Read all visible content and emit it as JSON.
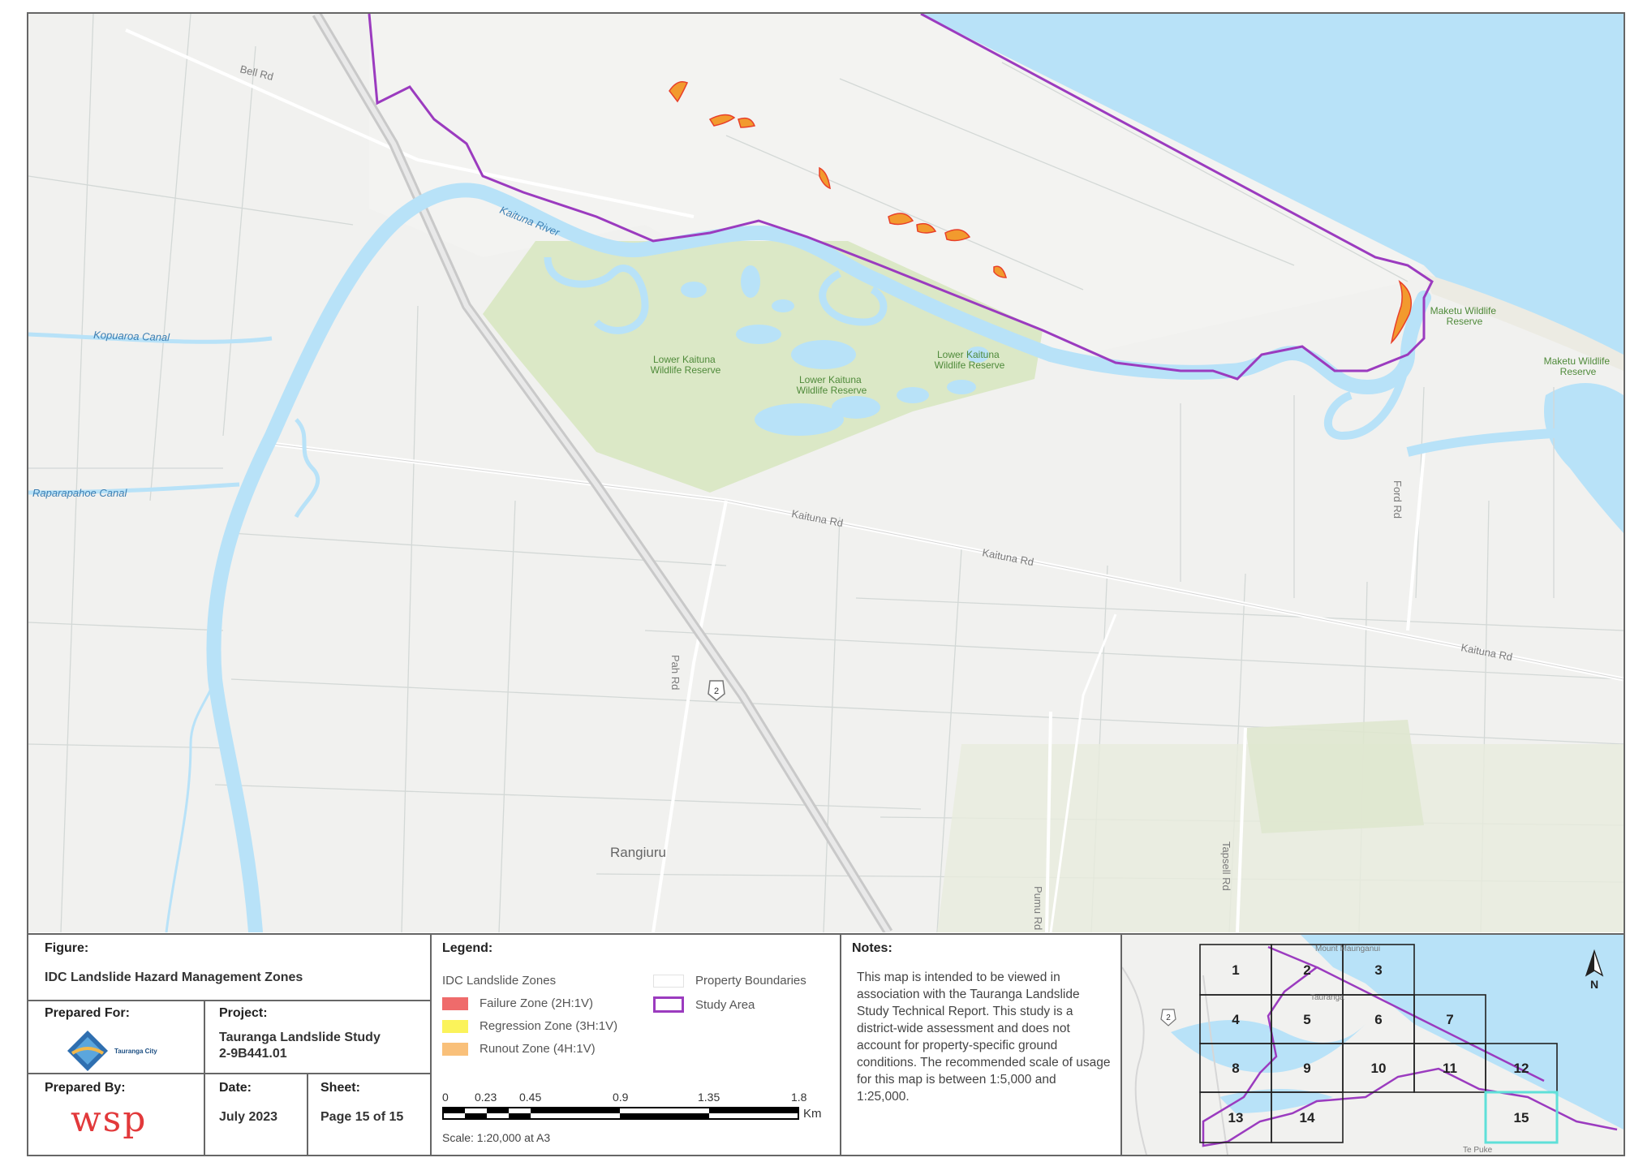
{
  "map": {
    "road_labels": [
      "Bell Rd",
      "Kaituna Rd",
      "Kaituna Rd",
      "Kaituna Rd",
      "Ford Rd",
      "Pah Rd",
      "Tapsell Rd",
      "Pumu Rd"
    ],
    "water_labels": [
      "Kopuaroa Canal",
      "Raparapahoe Canal",
      "Kaituna River"
    ],
    "reserve_labels": [
      "Lower Kaituna\nWildlife Reserve",
      "Lower Kaituna\nWildlife Reserve",
      "Lower Kaituna\nWildlife Reserve",
      "Maketu Wildlife\nReserve",
      "Maketu Wildlife\nReserve"
    ],
    "place_label": "Rangiuru",
    "highway_shield": "2",
    "colors": {
      "land": "#f1f1ef",
      "water": "#b8e2f8",
      "river": "#b8e2f8",
      "reserve": "#dbe8c6",
      "study_area": "#9b3bbf",
      "hazard_failure": "#e8402a",
      "hazard_runout": "#f29a2e"
    }
  },
  "figure": {
    "label": "Figure:",
    "title": "IDC Landslide Hazard Management Zones"
  },
  "prepared_for": {
    "label": "Prepared For:",
    "logo_text": "Tauranga City"
  },
  "project": {
    "label": "Project:",
    "name": "Tauranga Landslide Study",
    "number": "2-9B441.01"
  },
  "prepared_by": {
    "label": "Prepared By:",
    "logo_text": "wsp"
  },
  "date": {
    "label": "Date:",
    "value": "July 2023"
  },
  "sheet": {
    "label": "Sheet:",
    "value": "Page 15 of 15"
  },
  "legend": {
    "label": "Legend:",
    "group_title": "IDC Landslide Zones",
    "items": [
      {
        "label": "Failure Zone (2H:1V)",
        "color": "#ef6b6b"
      },
      {
        "label": "Regression Zone (3H:1V)",
        "color": "#fbf35a"
      },
      {
        "label": "Runout Zone (4H:1V)",
        "color": "#f9c07a"
      }
    ],
    "property_boundaries": "Property Boundaries",
    "study_area": "Study Area",
    "scale_ticks": [
      "0",
      "0.23",
      "0.45",
      "0.9",
      "1.35",
      "1.8"
    ],
    "scale_unit": "Km",
    "scale_text": "Scale: 1:20,000 at A3"
  },
  "notes": {
    "label": "Notes:",
    "text": "This map is intended to be viewed in association with the Tauranga Landslide Study Technical Report. This study is a district-wide assessment and does not account for property-specific ground conditions. The recommended scale of usage for this map is between 1:5,000 and 1:25,000."
  },
  "index_map": {
    "sheets": [
      "1",
      "2",
      "3",
      "4",
      "5",
      "6",
      "7",
      "8",
      "9",
      "10",
      "11",
      "12",
      "13",
      "14",
      "15"
    ],
    "current_sheet": "15",
    "north_label": "N",
    "place_labels": [
      "Mount Maunganui",
      "Tauranga",
      "Te Puke"
    ],
    "highway_shield": "2"
  }
}
